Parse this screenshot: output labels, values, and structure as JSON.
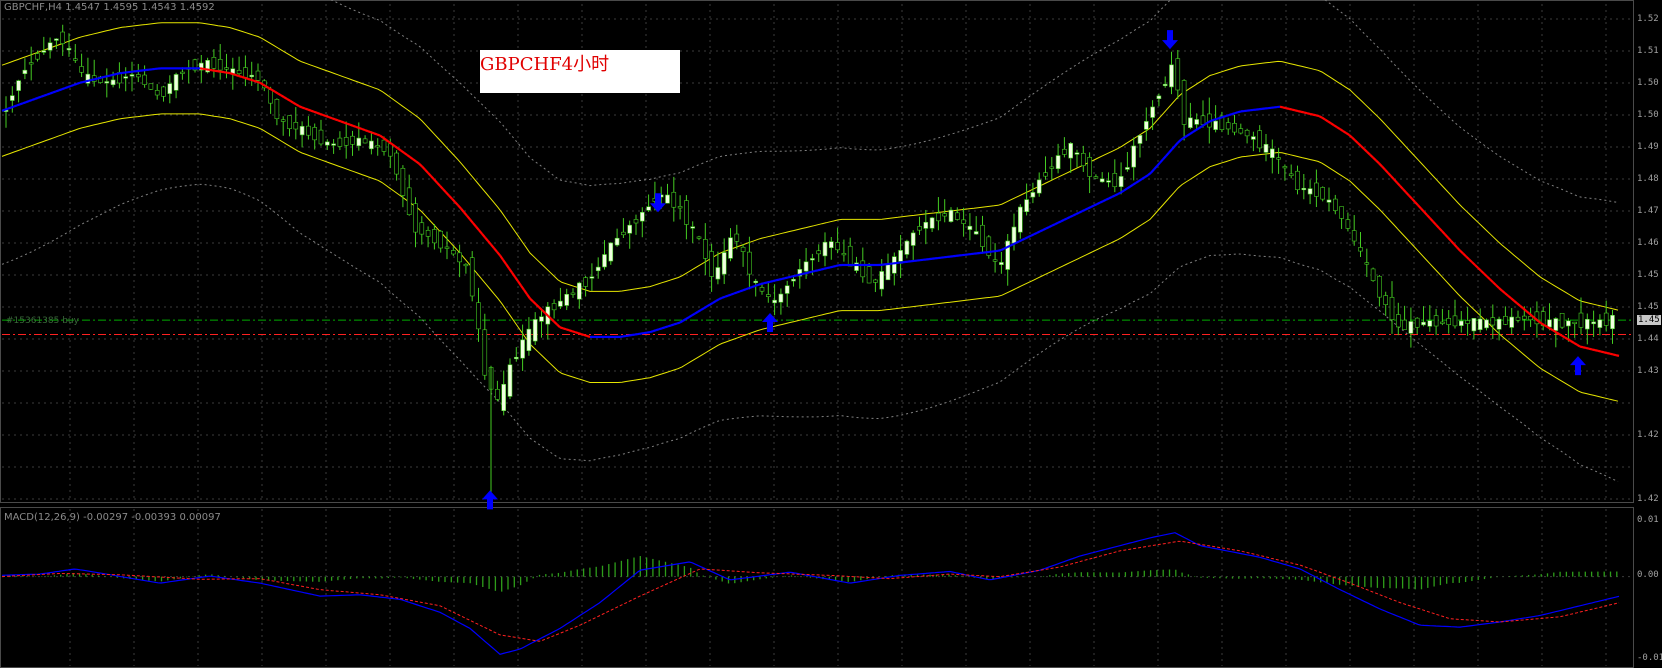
{
  "chart_info": {
    "symbol_timeframe": "GBPCHF,H4",
    "ohlc": [
      "1.4547",
      "1.4595",
      "1.4543",
      "1.4592"
    ],
    "note": "GBPCHF4小时"
  },
  "order": {
    "label": "#15361385 buy"
  },
  "indicator": {
    "macd_name": "MACD(12,26,9)",
    "macd_values": [
      "-0.00297",
      "-0.00393",
      "0.00097"
    ]
  },
  "price_axis": {
    "ticks": [
      "1.52",
      "1.51",
      "1.50",
      "1.50",
      "1.49",
      "1.48",
      "1.47",
      "1.46",
      "1.45",
      "1.45",
      "1.44",
      "1.43",
      "1.42",
      "1.42"
    ],
    "current_label": "1.45"
  },
  "macd_axis": {
    "ticks": [
      "0.01",
      "0.00",
      "-0.01"
    ]
  },
  "colors": {
    "background": "#000000",
    "bull_candle": "#f0ffe0",
    "bear_candle": "#000000",
    "wick": "#44cc22",
    "ma_up": "#0000ff",
    "ma_down": "#ff0000",
    "envelope": "#e6e600",
    "bands": "#808080",
    "grid": "#3c3c3c",
    "buy_line": "#00aa00",
    "entry_line": "#ff2020",
    "arrow": "#0000ff",
    "macd_hist": "#2e9e1a",
    "macd_main": "#0000ff",
    "macd_signal": "#ff2020"
  },
  "chart_data": {
    "type": "candlestick",
    "title": "GBPCHF,H4",
    "ylim": [
      1.418,
      1.521
    ],
    "buy_level": 1.4555,
    "entry_level": 1.4525,
    "close_path": [
      [
        0,
        1.497
      ],
      [
        25,
        1.508
      ],
      [
        60,
        1.515
      ],
      [
        85,
        1.506
      ],
      [
        110,
        1.505
      ],
      [
        135,
        1.507
      ],
      [
        160,
        1.502
      ],
      [
        185,
        1.508
      ],
      [
        210,
        1.509
      ],
      [
        240,
        1.507
      ],
      [
        260,
        1.506
      ],
      [
        280,
        1.497
      ],
      [
        305,
        1.495
      ],
      [
        330,
        1.492
      ],
      [
        360,
        1.493
      ],
      [
        390,
        1.491
      ],
      [
        415,
        1.475
      ],
      [
        445,
        1.471
      ],
      [
        470,
        1.466
      ],
      [
        485,
        1.445
      ],
      [
        500,
        1.438
      ],
      [
        515,
        1.448
      ],
      [
        540,
        1.456
      ],
      [
        565,
        1.46
      ],
      [
        590,
        1.464
      ],
      [
        615,
        1.472
      ],
      [
        640,
        1.477
      ],
      [
        660,
        1.482
      ],
      [
        680,
        1.479
      ],
      [
        700,
        1.472
      ],
      [
        715,
        1.464
      ],
      [
        735,
        1.474
      ],
      [
        755,
        1.463
      ],
      [
        775,
        1.459
      ],
      [
        800,
        1.466
      ],
      [
        830,
        1.472
      ],
      [
        855,
        1.467
      ],
      [
        875,
        1.463
      ],
      [
        895,
        1.468
      ],
      [
        920,
        1.475
      ],
      [
        950,
        1.478
      ],
      [
        980,
        1.473
      ],
      [
        1000,
        1.466
      ],
      [
        1020,
        1.478
      ],
      [
        1045,
        1.486
      ],
      [
        1070,
        1.492
      ],
      [
        1095,
        1.485
      ],
      [
        1120,
        1.484
      ],
      [
        1140,
        1.494
      ],
      [
        1160,
        1.503
      ],
      [
        1175,
        1.509
      ],
      [
        1185,
        1.497
      ],
      [
        1200,
        1.497
      ],
      [
        1225,
        1.496
      ],
      [
        1250,
        1.494
      ],
      [
        1275,
        1.49
      ],
      [
        1300,
        1.483
      ],
      [
        1320,
        1.482
      ],
      [
        1340,
        1.478
      ],
      [
        1360,
        1.47
      ],
      [
        1380,
        1.461
      ],
      [
        1400,
        1.454
      ],
      [
        1425,
        1.455
      ],
      [
        1450,
        1.455
      ],
      [
        1475,
        1.455
      ],
      [
        1500,
        1.455
      ],
      [
        1525,
        1.456
      ],
      [
        1550,
        1.455
      ],
      [
        1575,
        1.455
      ],
      [
        1600,
        1.455
      ],
      [
        1620,
        1.456
      ]
    ],
    "ma": [
      [
        0,
        1.499
      ],
      [
        40,
        1.502
      ],
      [
        80,
        1.505
      ],
      [
        120,
        1.507
      ],
      [
        160,
        1.508
      ],
      [
        200,
        1.508
      ],
      [
        230,
        1.507
      ],
      [
        260,
        1.505
      ],
      [
        300,
        1.5
      ],
      [
        340,
        1.497
      ],
      [
        380,
        1.494
      ],
      [
        420,
        1.488
      ],
      [
        460,
        1.479
      ],
      [
        500,
        1.469
      ],
      [
        530,
        1.46
      ],
      [
        560,
        1.454
      ],
      [
        590,
        1.452
      ],
      [
        620,
        1.452
      ],
      [
        650,
        1.453
      ],
      [
        680,
        1.455
      ],
      [
        720,
        1.46
      ],
      [
        760,
        1.463
      ],
      [
        800,
        1.465
      ],
      [
        840,
        1.467
      ],
      [
        880,
        1.467
      ],
      [
        920,
        1.468
      ],
      [
        960,
        1.469
      ],
      [
        1000,
        1.47
      ],
      [
        1040,
        1.474
      ],
      [
        1080,
        1.478
      ],
      [
        1120,
        1.482
      ],
      [
        1150,
        1.486
      ],
      [
        1180,
        1.493
      ],
      [
        1210,
        1.497
      ],
      [
        1240,
        1.499
      ],
      [
        1280,
        1.5
      ],
      [
        1320,
        1.498
      ],
      [
        1350,
        1.494
      ],
      [
        1380,
        1.488
      ],
      [
        1420,
        1.479
      ],
      [
        1460,
        1.47
      ],
      [
        1500,
        1.462
      ],
      [
        1540,
        1.455
      ],
      [
        1580,
        1.45
      ],
      [
        1620,
        1.448
      ]
    ],
    "macd_main": [
      [
        0,
        0.0002
      ],
      [
        40,
        0.0004
      ],
      [
        75,
        0.0012
      ],
      [
        110,
        0.0003
      ],
      [
        160,
        -0.001
      ],
      [
        210,
        0.0001
      ],
      [
        260,
        -0.001
      ],
      [
        320,
        -0.003
      ],
      [
        360,
        -0.0028
      ],
      [
        400,
        -0.0035
      ],
      [
        440,
        -0.0055
      ],
      [
        470,
        -0.008
      ],
      [
        500,
        -0.012
      ],
      [
        520,
        -0.0112
      ],
      [
        560,
        -0.008
      ],
      [
        600,
        -0.004
      ],
      [
        640,
        0.001
      ],
      [
        690,
        0.0023
      ],
      [
        730,
        -0.0005
      ],
      [
        790,
        0.0007
      ],
      [
        850,
        -0.001
      ],
      [
        900,
        0.0002
      ],
      [
        950,
        0.0008
      ],
      [
        990,
        -0.0005
      ],
      [
        1040,
        0.001
      ],
      [
        1080,
        0.0032
      ],
      [
        1150,
        0.006
      ],
      [
        1175,
        0.0068
      ],
      [
        1200,
        0.0048
      ],
      [
        1260,
        0.003
      ],
      [
        1300,
        0.0012
      ],
      [
        1340,
        -0.002
      ],
      [
        1380,
        -0.005
      ],
      [
        1420,
        -0.0075
      ],
      [
        1460,
        -0.0078
      ],
      [
        1500,
        -0.007
      ],
      [
        1540,
        -0.006
      ],
      [
        1580,
        -0.0045
      ],
      [
        1620,
        -0.003
      ]
    ],
    "macd_signal": [
      [
        0,
        0.0
      ],
      [
        60,
        0.0005
      ],
      [
        120,
        0.0003
      ],
      [
        200,
        -0.0004
      ],
      [
        260,
        -0.0003
      ],
      [
        320,
        -0.002
      ],
      [
        380,
        -0.0028
      ],
      [
        440,
        -0.0045
      ],
      [
        500,
        -0.009
      ],
      [
        540,
        -0.01
      ],
      [
        580,
        -0.0075
      ],
      [
        640,
        -0.003
      ],
      [
        700,
        0.0012
      ],
      [
        760,
        0.0006
      ],
      [
        830,
        0.0002
      ],
      [
        890,
        -0.0003
      ],
      [
        950,
        0.0004
      ],
      [
        1000,
        0.0
      ],
      [
        1060,
        0.0015
      ],
      [
        1120,
        0.004
      ],
      [
        1180,
        0.0055
      ],
      [
        1240,
        0.004
      ],
      [
        1300,
        0.0018
      ],
      [
        1350,
        -0.001
      ],
      [
        1400,
        -0.004
      ],
      [
        1450,
        -0.0065
      ],
      [
        1500,
        -0.007
      ],
      [
        1560,
        -0.0062
      ],
      [
        1620,
        -0.004
      ]
    ],
    "macd_ylim": [
      -0.0135,
      0.01
    ],
    "arrows": [
      {
        "x": 658,
        "dir": "down",
        "price": 1.478
      },
      {
        "x": 1170,
        "dir": "down",
        "price": 1.512
      },
      {
        "x": 490,
        "dir": "up",
        "price": 1.42
      },
      {
        "x": 770,
        "dir": "up",
        "price": 1.457
      },
      {
        "x": 1578,
        "dir": "up",
        "price": 1.448
      }
    ]
  }
}
